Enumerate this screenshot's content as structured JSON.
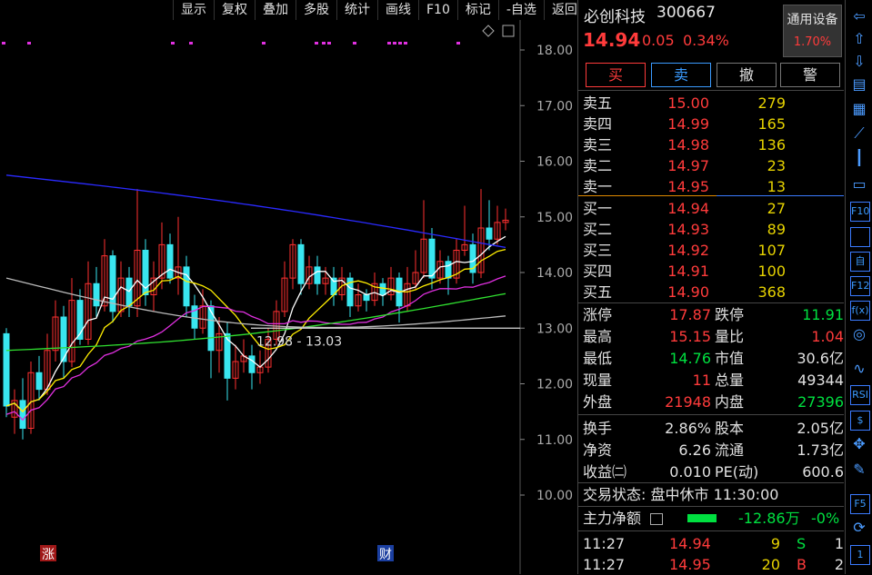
{
  "toolbar": {
    "items": [
      "显示",
      "复权",
      "叠加",
      "多股",
      "统计",
      "画线",
      "F10",
      "标记",
      "-自选",
      "返回"
    ]
  },
  "chart": {
    "y_labels": [
      "18.00",
      "17.00",
      "16.00",
      "15.00",
      "14.00",
      "13.00",
      "12.00",
      "11.00",
      "10.00"
    ],
    "range_annotation": "12.98 - 13.03",
    "marker_zhang": "涨",
    "marker_cai": "财",
    "colors": {
      "up": "#ff3030",
      "down": "#39e6f0",
      "ma5": "#ffffff",
      "ma10": "#ffee00",
      "ma20": "#e030e0",
      "ma60": "#30e030",
      "ma120": "#bbbbbb",
      "ma250": "#2a2aff"
    }
  },
  "quote": {
    "name": "必创科技",
    "code": "300667",
    "price": "14.94",
    "change": "0.05",
    "change_pct": "0.34%",
    "sector_name": "通用设备",
    "sector_pct": "1.70%",
    "buttons": {
      "buy": "买",
      "sell": "卖",
      "cancel": "撤",
      "alert": "警"
    },
    "asks": [
      {
        "label": "卖五",
        "price": "15.00",
        "vol": "279"
      },
      {
        "label": "卖四",
        "price": "14.99",
        "vol": "165"
      },
      {
        "label": "卖三",
        "price": "14.98",
        "vol": "136"
      },
      {
        "label": "卖二",
        "price": "14.97",
        "vol": "23"
      },
      {
        "label": "卖一",
        "price": "14.95",
        "vol": "13"
      }
    ],
    "bids": [
      {
        "label": "买一",
        "price": "14.94",
        "vol": "27"
      },
      {
        "label": "买二",
        "price": "14.93",
        "vol": "89"
      },
      {
        "label": "买三",
        "price": "14.92",
        "vol": "107"
      },
      {
        "label": "买四",
        "price": "14.91",
        "vol": "100"
      },
      {
        "label": "买五",
        "price": "14.90",
        "vol": "368"
      }
    ],
    "stats": {
      "limit_up_label": "涨停",
      "limit_up": "17.87",
      "limit_down_label": "跌停",
      "limit_down": "11.91",
      "high_label": "最高",
      "high": "15.15",
      "vol_ratio_label": "量比",
      "vol_ratio": "1.04",
      "low_label": "最低",
      "low": "14.76",
      "mcap_label": "市值",
      "mcap": "30.6亿",
      "cur_vol_label": "现量",
      "cur_vol": "11",
      "total_vol_label": "总量",
      "total_vol": "49344",
      "outer_label": "外盘",
      "outer": "21948",
      "inner_label": "内盘",
      "inner": "27396",
      "turnover_label": "换手",
      "turnover": "2.86%",
      "equity_label": "股本",
      "equity": "2.05亿",
      "nav_label": "净资",
      "nav": "6.26",
      "float_label": "流通",
      "float": "1.73亿",
      "eps_label": "收益㈡",
      "eps": "0.010",
      "pe_label": "PE(动)",
      "pe": "600.6"
    },
    "trade_status": "交易状态: 盘中休市 11:30:00",
    "main_flow_label": "主力净额",
    "main_flow_value": "-12.86万",
    "main_flow_pct": "-0%",
    "ticks": [
      {
        "time": "11:27",
        "price": "14.94",
        "vol": "9",
        "side": "S",
        "count": "1"
      },
      {
        "time": "11:27",
        "price": "14.95",
        "vol": "20",
        "side": "B",
        "count": "2"
      }
    ]
  },
  "right_toolbar": {
    "icons": [
      "arrow-left-icon",
      "arrow-up-icon",
      "arrow-down-icon",
      "order-list-icon",
      "table-icon",
      "line-chart-icon",
      "kline-icon",
      "document-icon",
      "f10-icon",
      "f-list-icon",
      "self-select-icon",
      "f12-icon",
      "fx-icon",
      "circle-icon",
      "wave-icon",
      "rsi-icon",
      "dollar-icon",
      "move-icon",
      "pencil-icon",
      "f5-icon",
      "refresh-icon",
      "one-icon"
    ],
    "text": {
      "f10": "F10",
      "self": "自",
      "f12": "F12",
      "fx": "f(x)",
      "rsi": "RSI",
      "dollar": "$",
      "f5": "F5",
      "one": "1"
    }
  }
}
